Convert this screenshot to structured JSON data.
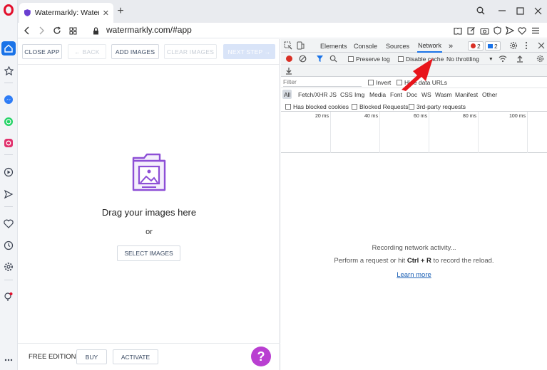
{
  "browser": {
    "tab_title": "Watermarkly: Watermark P",
    "new_tab_symbol": "+",
    "url": "watermarkly.com/#app"
  },
  "app": {
    "toolbar": {
      "close_app": "CLOSE APP",
      "back": "← BACK",
      "add_images": "ADD IMAGES",
      "clear_images": "CLEAR IMAGES",
      "next_step": "NEXT STEP →"
    },
    "drop_zone": {
      "title": "Drag your images here",
      "or": "or",
      "select_images": "SELECT IMAGES"
    },
    "footer": {
      "edition": "FREE EDITION",
      "buy": "BUY",
      "activate": "ACTIVATE",
      "help": "?"
    },
    "colors": {
      "accent": "#b93fd1",
      "icon_purple": "#8d4fd6"
    }
  },
  "devtools": {
    "tabs": [
      "Elements",
      "Console",
      "Sources",
      "Network"
    ],
    "more_tabs": "»",
    "error_count": "2",
    "message_count": "2",
    "toolbar": {
      "preserve_log": "Preserve log",
      "disable_cache": "Disable cache",
      "throttling": "No throttling"
    },
    "filter_placeholder": "Filter",
    "invert": "Invert",
    "hide_data_urls": "Hide data URLs",
    "types": [
      "All",
      "Fetch/XHR",
      "JS",
      "CSS",
      "Img",
      "Media",
      "Font",
      "Doc",
      "WS",
      "Wasm",
      "Manifest",
      "Other"
    ],
    "has_blocked_cookies": "Has blocked cookies",
    "blocked_requests": "Blocked Requests",
    "third_party": "3rd-party requests",
    "timeline_ticks": [
      "20 ms",
      "40 ms",
      "60 ms",
      "80 ms",
      "100 ms"
    ],
    "empty": {
      "title": "Recording network activity...",
      "hint_pre": "Perform a request or hit ",
      "hint_key": "Ctrl + R",
      "hint_post": " to record the reload.",
      "learn_more": "Learn more"
    },
    "colors": {
      "active_tab": "#1a73e8",
      "record": "#d93025",
      "link": "#1a5fb4"
    }
  },
  "annotation": {
    "arrow_color": "#e8141b"
  }
}
